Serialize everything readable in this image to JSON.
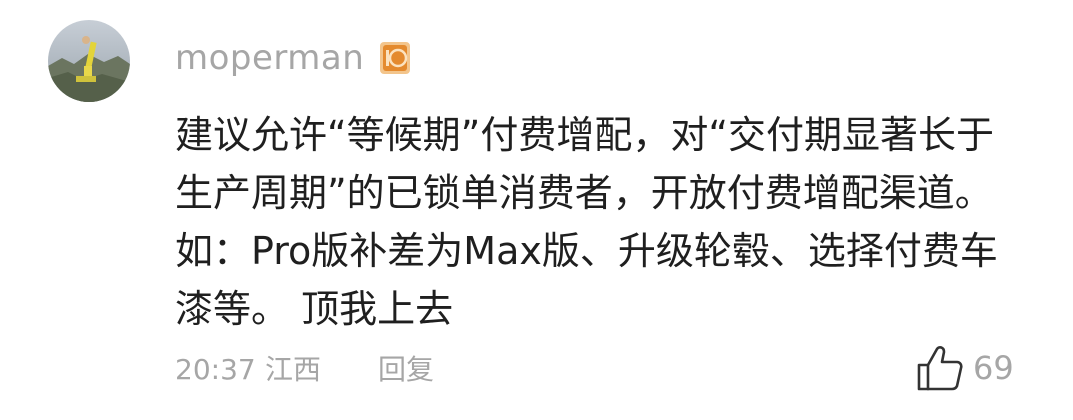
{
  "comment": {
    "username": "moperman",
    "level_badge": "10",
    "text_lines": [
      "建议允许“等候期”付费增配，对“交付期显著长于",
      "生产周期”的已锁单消费者，开放付费增配渠道。",
      "如：Pro版补差为Max版、升级轮毂、选择付费车",
      "漆等。 顶我上去"
    ],
    "time": "20:37",
    "location": "江西",
    "reply_label": "回复",
    "like_count": "69"
  },
  "icons": {
    "avatar": "avatar-image",
    "badge": "level-badge-icon",
    "like": "thumbs-up-icon"
  },
  "colors": {
    "meta_gray": "#a6a6a6",
    "text": "#1f1f1f",
    "badge_orange": "#e48a2e"
  }
}
